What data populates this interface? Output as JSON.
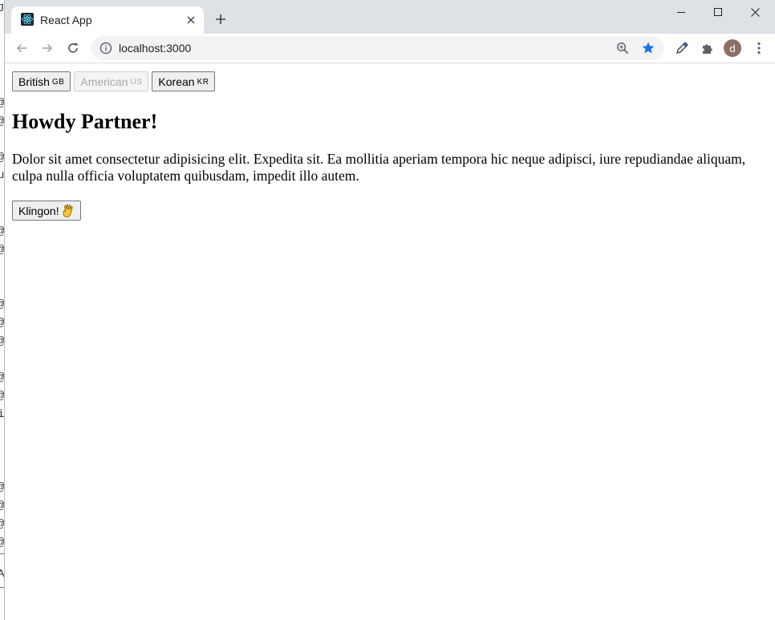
{
  "browser": {
    "tab": {
      "title": "React App",
      "favicon": "react-icon"
    },
    "window_controls": [
      "minimize-icon",
      "maximize-icon",
      "close-icon"
    ],
    "address_bar": {
      "url": "localhost:3000"
    },
    "profile": {
      "initial": "d",
      "color": "#8d6e63"
    },
    "accent_color": "#1a73e8"
  },
  "page": {
    "language_buttons": [
      {
        "label": "British",
        "flag": "GB",
        "disabled": false
      },
      {
        "label": "American",
        "flag": "US",
        "disabled": true
      },
      {
        "label": "Korean",
        "flag": "KR",
        "disabled": false
      }
    ],
    "heading": "Howdy Partner!",
    "paragraph": "Dolor sit amet consectetur adipisicing elit. Expedita sit. Ea mollitia aperiam tempora hic neque adipisci, iure repudiandae aliquam, culpa nulla officia voluptatem quibusdam, impedit illo autem.",
    "klingon_button": {
      "label": "Klingon!",
      "icon": "vulcan-salute-icon"
    }
  }
}
